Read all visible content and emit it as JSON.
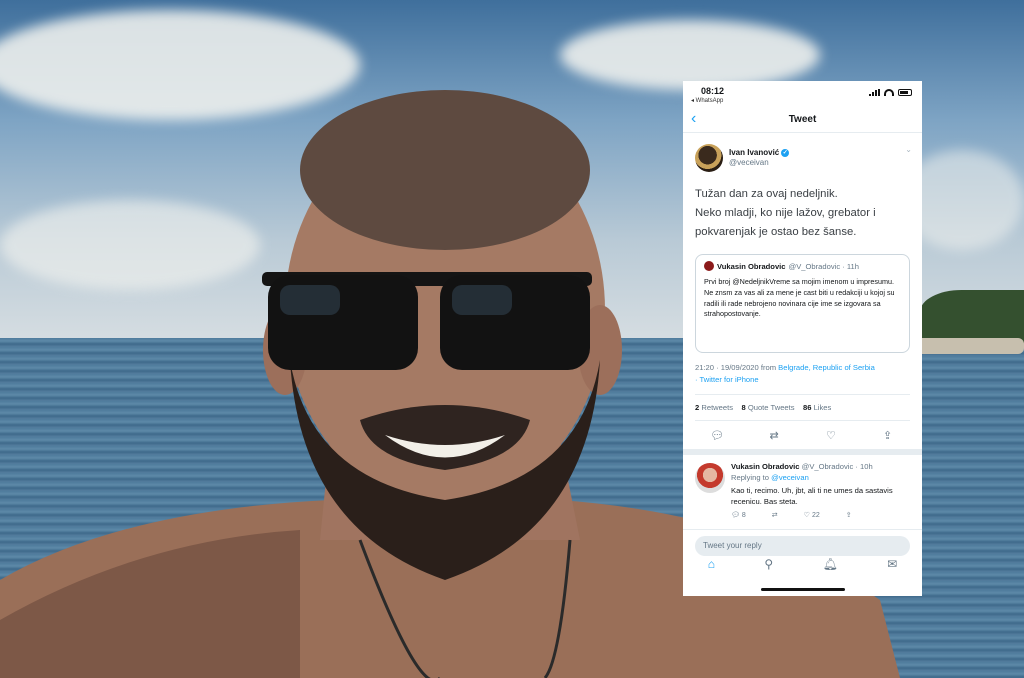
{
  "phone": {
    "status": {
      "time": "08:12",
      "back_app": "◂ WhatsApp"
    },
    "nav": {
      "back_icon": "chevron-left-icon",
      "title": "Tweet"
    },
    "tweet": {
      "author_name": "Ivan Ivanović",
      "author_handle": "@veceivan",
      "text": "Tužan dan za ovaj nedeljnik.\nNeko mladji, ko nije lažov, grebator i pokvarenjak je ostao bez šanse.",
      "quote": {
        "name": "Vukasin Obradovic",
        "meta": "@V_Obradovic · 11h",
        "text": "Prvi broj @NedeljnikVreme sa mojim imenom u impresumu. Ne znsm za vas ali za mene je cast biti u redakciji u kojoj su radili ili rade nebrojeno novinara cije ime se izgovara sa strahopostovanje."
      },
      "timestamp": "21:20 · 19/09/2020 from ",
      "location": "Belgrade, Republic of Serbia",
      "source": "Twitter for iPhone",
      "retweets": "2",
      "retweets_label": "Retweets",
      "quote_tweets": "8",
      "quote_tweets_label": "Quote Tweets",
      "likes": "86",
      "likes_label": "Likes"
    },
    "reply": {
      "name": "Vukasin Obradovic",
      "meta": "@V_Obradovic · 10h",
      "replying_prefix": "Replying to ",
      "replying_to": "@veceivan",
      "text": "Kao ti, recimo. Uh, jbt, ali ti ne umes da sastavis recenicu. Bas steta.",
      "reply_count": "8",
      "like_count": "22"
    },
    "compose_placeholder": "Tweet your reply",
    "tabs": [
      "home-icon",
      "search-icon",
      "bell-icon",
      "mail-icon"
    ]
  }
}
